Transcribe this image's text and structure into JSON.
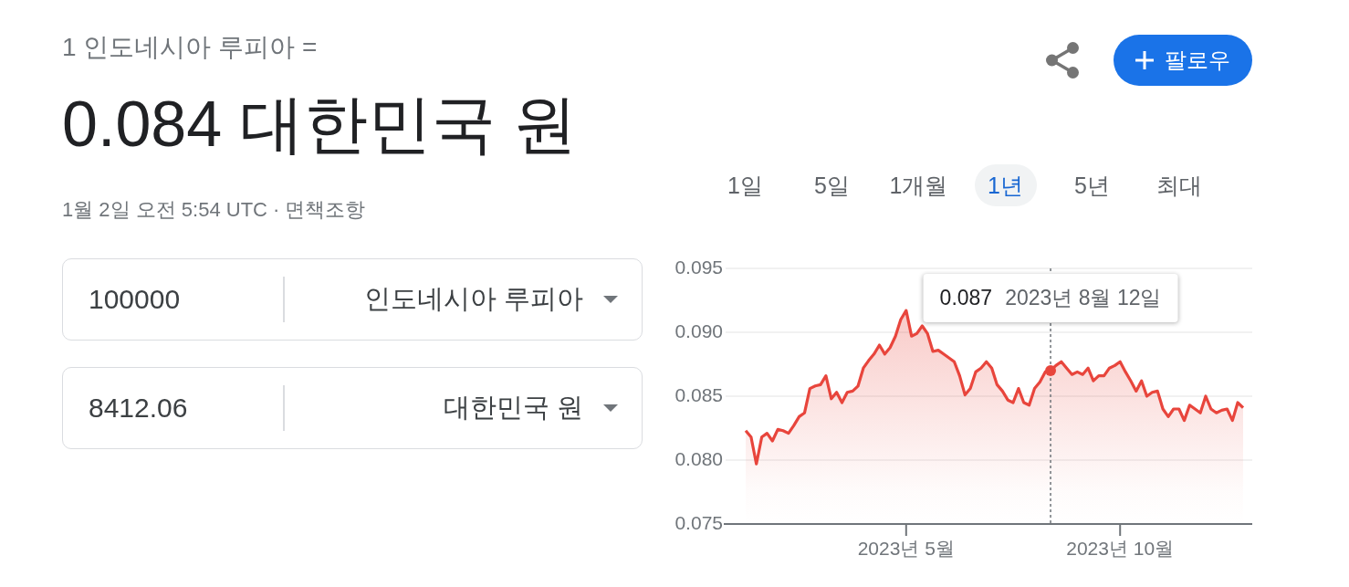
{
  "header": {
    "pair_label": "1 인도네시아 루피아 =",
    "rate": "0.084 대한민국 원",
    "timestamp": "1월 2일 오전 5:54 UTC",
    "separator": "·",
    "disclaimer_link": "면책조항"
  },
  "actions": {
    "follow_button": "팔로우"
  },
  "converter": [
    {
      "amount": "100000",
      "currency": "인도네시아 루피아"
    },
    {
      "amount": "8412.06",
      "currency": "대한민국 원"
    }
  ],
  "range_tabs": [
    {
      "label": "1일",
      "selected": false
    },
    {
      "label": "5일",
      "selected": false
    },
    {
      "label": "1개월",
      "selected": false
    },
    {
      "label": "1년",
      "selected": true
    },
    {
      "label": "5년",
      "selected": false
    },
    {
      "label": "최대",
      "selected": false
    }
  ],
  "chart": {
    "chart_data": {
      "type": "area",
      "grid": true,
      "categories": [
        null,
        null,
        null,
        null,
        null,
        null,
        null,
        null,
        null,
        null,
        null,
        null,
        null,
        null,
        null,
        null,
        null,
        null,
        null,
        null,
        null,
        null,
        null,
        null,
        null,
        null,
        null,
        null,
        null,
        null,
        "2023년 5월",
        null,
        null,
        null,
        null,
        null,
        null,
        null,
        null,
        null,
        null,
        null,
        null,
        null,
        null,
        null,
        null,
        null,
        null,
        null,
        null,
        null,
        null,
        null,
        null,
        null,
        null,
        null,
        null,
        null,
        null,
        null,
        null,
        null,
        null,
        null,
        null,
        null,
        null,
        null,
        "2023년 10월",
        null,
        null,
        null,
        null,
        null,
        null,
        null,
        null,
        null,
        null,
        null,
        null,
        null,
        null,
        null,
        null,
        null,
        null,
        null,
        null,
        null,
        null,
        null
      ],
      "series": [
        {
          "color": "#e8453c",
          "values": [
            0.0823,
            0.0818,
            0.0797,
            0.0818,
            0.0821,
            0.0815,
            0.0824,
            0.0823,
            0.0821,
            0.0827,
            0.0834,
            0.0837,
            0.0856,
            0.0858,
            0.0859,
            0.0866,
            0.0848,
            0.0853,
            0.0845,
            0.0853,
            0.0854,
            0.0858,
            0.0872,
            0.0878,
            0.0883,
            0.089,
            0.0883,
            0.0888,
            0.0897,
            0.091,
            0.0917,
            0.0897,
            0.0899,
            0.0905,
            0.0899,
            0.0885,
            0.0886,
            0.0883,
            0.088,
            0.0877,
            0.0866,
            0.0851,
            0.0856,
            0.0869,
            0.0872,
            0.0877,
            0.0872,
            0.0859,
            0.0854,
            0.0847,
            0.0845,
            0.0856,
            0.0845,
            0.0843,
            0.0856,
            0.0861,
            0.0869,
            0.087,
            0.0874,
            0.0877,
            0.0872,
            0.0867,
            0.0869,
            0.0867,
            0.0872,
            0.0862,
            0.0866,
            0.0866,
            0.0872,
            0.0874,
            0.0877,
            0.0869,
            0.0862,
            0.0854,
            0.0862,
            0.085,
            0.0853,
            0.0854,
            0.084,
            0.0834,
            0.084,
            0.084,
            0.0831,
            0.0843,
            0.084,
            0.0837,
            0.085,
            0.084,
            0.0837,
            0.0839,
            0.084,
            0.0831,
            0.0845,
            0.0841
          ]
        }
      ],
      "ylim": [
        0.075,
        0.095
      ],
      "yticks": [
        {
          "value": 0.075,
          "label": "0.075"
        },
        {
          "value": 0.08,
          "label": "0.080"
        },
        {
          "value": 0.085,
          "label": "0.085"
        },
        {
          "value": 0.09,
          "label": "0.090"
        },
        {
          "value": 0.095,
          "label": "0.095"
        }
      ],
      "annotations": [
        "0.087",
        "2023년 8월 12일"
      ]
    }
  }
}
